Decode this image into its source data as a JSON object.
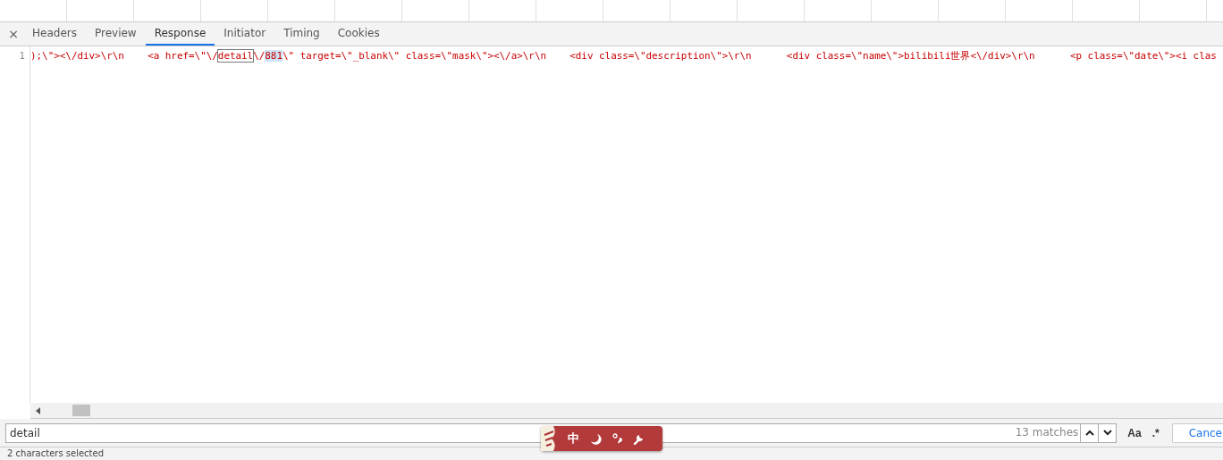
{
  "close_tab": "×",
  "tabs": [
    {
      "label": "Headers",
      "selected": false
    },
    {
      "label": "Preview",
      "selected": false
    },
    {
      "label": "Response",
      "selected": true
    },
    {
      "label": "Initiator",
      "selected": false
    },
    {
      "label": "Timing",
      "selected": false
    },
    {
      "label": "Cookies",
      "selected": false
    }
  ],
  "code": {
    "line_number": "1",
    "segments": [
      {
        "kind": "plain",
        "text": ");\\\"><\\/div>\\r\\n    <a href=\\\"\\/"
      },
      {
        "kind": "match",
        "text": "detail"
      },
      {
        "kind": "plain",
        "text": "\\/"
      },
      {
        "kind": "selected",
        "text": "881"
      },
      {
        "kind": "plain",
        "text": "\\\" target=\\\"_blank\\\" class=\\\"mask\\\"><\\/a>\\r\\n    <div class=\\\"description\\\">\\r\\n      <div class=\\\"name\\\">bilibili世界<\\/div>\\r\\n      <p class=\\\"date\\\"><i clas"
      }
    ]
  },
  "search": {
    "value": "detail",
    "matches": "13 matches",
    "case_toggle": "Aa",
    "regex_toggle": ".*",
    "cancel": "Cance"
  },
  "ime_toolbar": {
    "label": "中"
  },
  "status": "2 characters selected"
}
